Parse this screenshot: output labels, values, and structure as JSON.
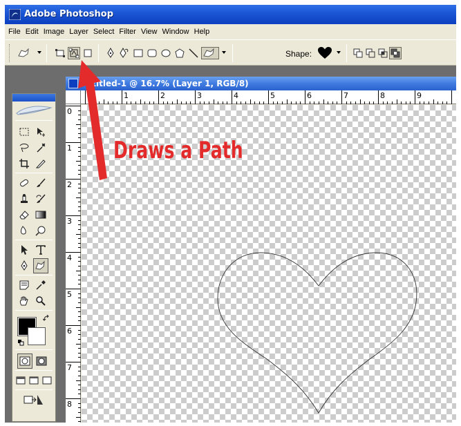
{
  "window": {
    "title": "Adobe Photoshop"
  },
  "menu": [
    "File",
    "Edit",
    "Image",
    "Layer",
    "Select",
    "Filter",
    "View",
    "Window",
    "Help"
  ],
  "options": {
    "shape_label": "Shape:",
    "shape_icon": "heart-icon",
    "path_mode_selected": true
  },
  "document": {
    "title": "Untitled-1 @ 16.7% (Layer 1, RGB/8)",
    "ruler_top": [
      "1",
      "2",
      "3",
      "4",
      "5",
      "6",
      "7",
      "8",
      "9"
    ],
    "ruler_left": [
      "0",
      "1",
      "2",
      "3",
      "4",
      "5",
      "6",
      "7",
      "8"
    ]
  },
  "annotation": {
    "text": "Draws a Path",
    "color": "#e42b2b"
  },
  "colors": {
    "titlebar": "#0b3fbf",
    "chrome": "#ece9d8",
    "workspace": "#6d6d6d"
  }
}
